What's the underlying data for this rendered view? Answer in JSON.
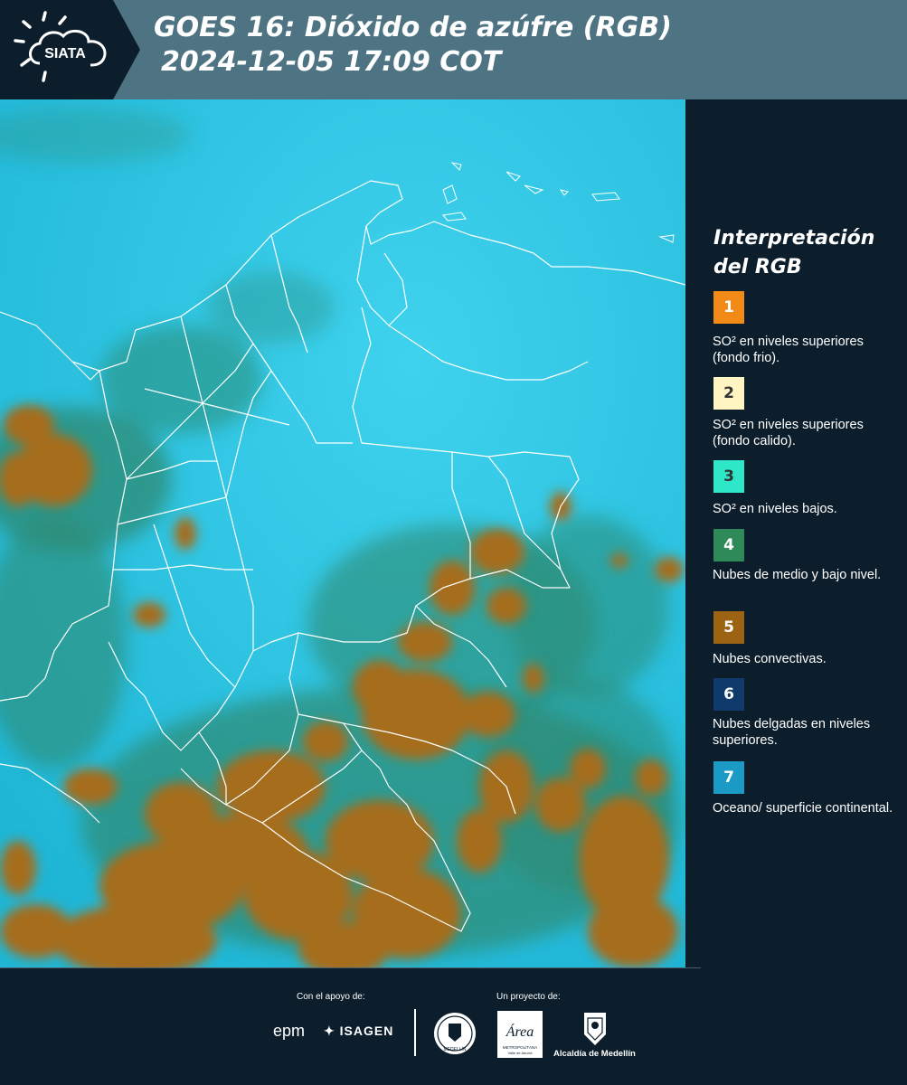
{
  "header": {
    "logo_text": "SIATA",
    "title_line1": "GOES 16: Dióxido de azúfre (RGB)",
    "title_line2": "2024-12-05 17:09 COT"
  },
  "legend": {
    "title_line1": "Interpretación",
    "title_line2": "del RGB",
    "items": [
      {
        "number": "1",
        "color": "#f28a17",
        "text": "SO² en niveles superiores (fondo frio)."
      },
      {
        "number": "2",
        "color": "#fff5c2",
        "text": "SO² en niveles superiores (fondo calido)."
      },
      {
        "number": "3",
        "color": "#2ee6c8",
        "text": "SO² en niveles bajos."
      },
      {
        "number": "4",
        "color": "#2f8a5a",
        "text": "Nubes de medio y bajo nivel."
      },
      {
        "number": "5",
        "color": "#9c6412",
        "text": "Nubes convectivas."
      },
      {
        "number": "6",
        "color": "#0f3a6b",
        "text": "Nubes delgadas en niveles superiores."
      },
      {
        "number": "7",
        "color": "#1a9ac4",
        "text": "Oceano/ superficie continental."
      }
    ]
  },
  "footer": {
    "support_label": "Con el apoyo de:",
    "project_label": "Un proyecto de:",
    "sponsor_1": "epm",
    "sponsor_2": "ISAGEN",
    "partner_1_text": "MEDELLÍN",
    "partner_2_name": "Área",
    "partner_2_text": "METROPOLITANA Valle de Aburrá",
    "partner_3_name": "Alcaldía de Medellín"
  },
  "colors": {
    "header_bg": "#4e7483",
    "panel_bg": "#0c1e2c",
    "ocean": "#28c4e2",
    "convective": "#9c6412"
  }
}
